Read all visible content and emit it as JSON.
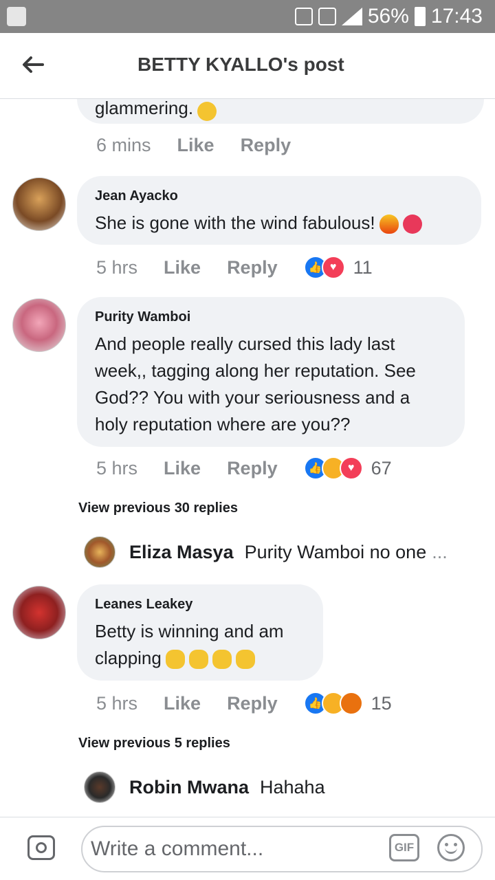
{
  "status_bar": {
    "battery": "56%",
    "time": "17:43"
  },
  "header": {
    "title": "BETTY KYALLO's post"
  },
  "top_partial": {
    "text": "glammering.",
    "timestamp": "6 mins",
    "like": "Like",
    "reply": "Reply"
  },
  "comments": [
    {
      "author": "Jean Ayacko",
      "text": "She is gone with the wind fabulous!",
      "timestamp": "5 hrs",
      "like": "Like",
      "reply": "Reply",
      "reaction_count": "11"
    },
    {
      "author": "Purity Wamboi",
      "text": "And people really cursed this lady last week,, tagging along her reputation. See God?? You with your seriousness and a holy reputation where are you??",
      "timestamp": "5 hrs",
      "like": "Like",
      "reply": "Reply",
      "reaction_count": "67",
      "view_previous": "View previous 30 replies",
      "reply_preview": {
        "author": "Eliza Masya",
        "text": "Purity Wamboi no one",
        "ellipsis": "..."
      }
    },
    {
      "author": "Leanes Leakey",
      "text": "Betty is winning and am clapping",
      "timestamp": "5 hrs",
      "like": "Like",
      "reply": "Reply",
      "reaction_count": "15",
      "view_previous": "View previous 5 replies",
      "reply_preview": {
        "author": "Robin Mwana",
        "text": "Hahaha"
      }
    }
  ],
  "composer": {
    "placeholder": "Write a comment...",
    "gif_label": "GIF"
  },
  "colors": {
    "bubble": "#f0f2f5",
    "like_blue": "#1877f2",
    "love_red": "#f33e58",
    "haha_yellow": "#f7b125",
    "angry_orange": "#e9710f",
    "status_gray": "#858585"
  }
}
